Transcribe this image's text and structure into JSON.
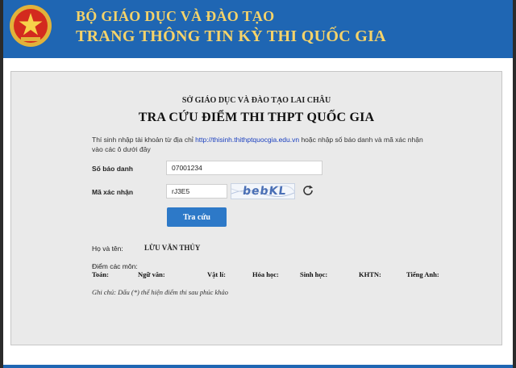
{
  "header": {
    "line1": "BỘ GIÁO DỤC VÀ ĐÀO TẠO",
    "line2": "TRANG THÔNG TIN KỲ THI QUỐC GIA",
    "emblem_icon": "state-emblem-icon",
    "colors": {
      "bar": "#1f66b3",
      "text": "#f5d36a"
    }
  },
  "form": {
    "department": "SỞ GIÁO DỤC VÀ ĐÀO TẠO LAI CHÂU",
    "title": "TRA CỨU ĐIỂM THI THPT QUỐC GIA",
    "intro_before": "Thí sinh nhập tài khoản từ địa chỉ ",
    "intro_link": "http://thisinh.thithptquocgia.edu.vn",
    "intro_after": " hoặc nhập số báo danh và mã xác nhận vào các ô dưới đây",
    "sbd_label": "Số báo danh",
    "sbd_value": "07001234",
    "captcha_label": "Mã xác nhận",
    "captcha_value": "rJ3E5",
    "captcha_image_text": "bebKL",
    "refresh_icon": "refresh-icon",
    "search_button": "Tra cứu",
    "button_color": "#2d79c8"
  },
  "result": {
    "name_label": "Họ và tên:",
    "name_value": "LỪU VĂN THỦY",
    "scores_label": "Điểm các môn:",
    "subjects": [
      {
        "label": "Toán:"
      },
      {
        "label": "Ngữ văn:"
      },
      {
        "label": "Vật lí:"
      },
      {
        "label": "Hóa học:"
      },
      {
        "label": "Sinh học:"
      },
      {
        "label": "KHTN:"
      },
      {
        "label": "Tiếng Anh:"
      }
    ],
    "note": "Ghi chú: Dấu (*) thể hiện điểm thi sau phúc khảo"
  }
}
